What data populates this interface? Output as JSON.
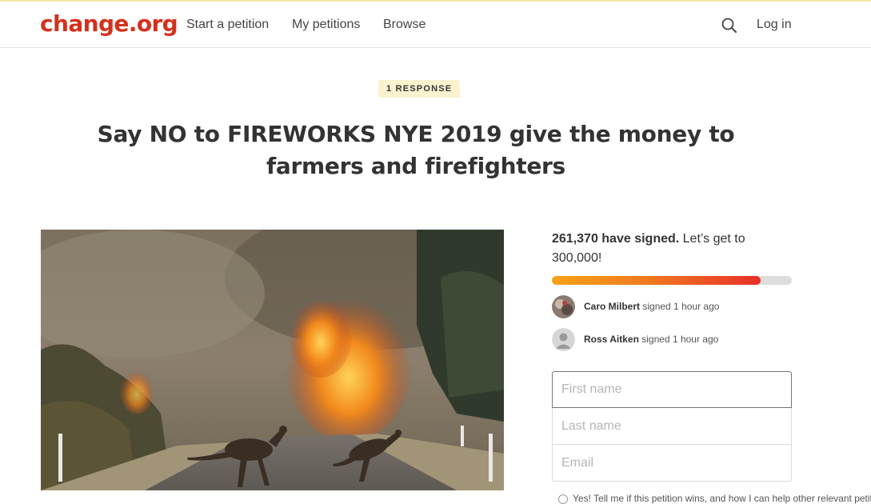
{
  "header": {
    "logo": "change.org",
    "nav": [
      "Start a petition",
      "My petitions",
      "Browse"
    ],
    "search_icon": "search-icon",
    "login": "Log in"
  },
  "petition": {
    "badge": "1 RESPONSE",
    "title": "Say NO to FIREWORKS NYE 2019 give the money to farmers and firefighters"
  },
  "signatures": {
    "count_text": "261,370 have signed.",
    "goal_text": "Let’s get to 300,000!",
    "progress_fraction": 0.8712,
    "recent": [
      {
        "name": "Caro Milbert",
        "action": "signed 1 hour ago"
      },
      {
        "name": "Ross Aitken",
        "action": "signed 1 hour ago"
      }
    ]
  },
  "form": {
    "first_name_placeholder": "First name",
    "last_name_placeholder": "Last name",
    "email_placeholder": "Email",
    "checkbox_text": "Yes! Tell me if this petition wins, and how I can help other relevant petitions."
  },
  "colors": {
    "brand": "#d4311d",
    "badge_bg": "#fbf2cf",
    "progress_start": "#f7a21a",
    "progress_end": "#e8302a"
  }
}
